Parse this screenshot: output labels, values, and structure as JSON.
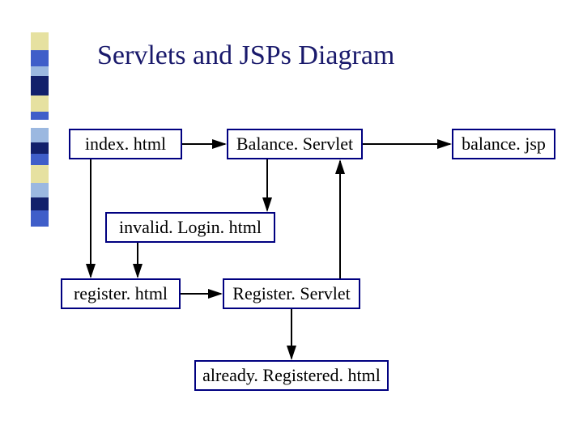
{
  "title": "Servlets and JSPs Diagram",
  "nodes": {
    "index": "index. html",
    "balance_servlet": "Balance. Servlet",
    "balance_jsp": "balance. jsp",
    "invalid_login": "invalid. Login. html",
    "register_html": "register. html",
    "register_servlet": "Register. Servlet",
    "already_registered": "already. Registered. html"
  },
  "decor_colors": [
    "#e6e1a0",
    "#3f4db8",
    "#9bb8e0",
    "#1a2a6b",
    "#e6e1a0",
    "#3f4db8",
    "#ffffff",
    "#9bb8e0",
    "#1a2a6b",
    "#3f4db8",
    "#e6e1a0",
    "#9bb8e0",
    "#1a2a6b",
    "#3f4db8"
  ]
}
